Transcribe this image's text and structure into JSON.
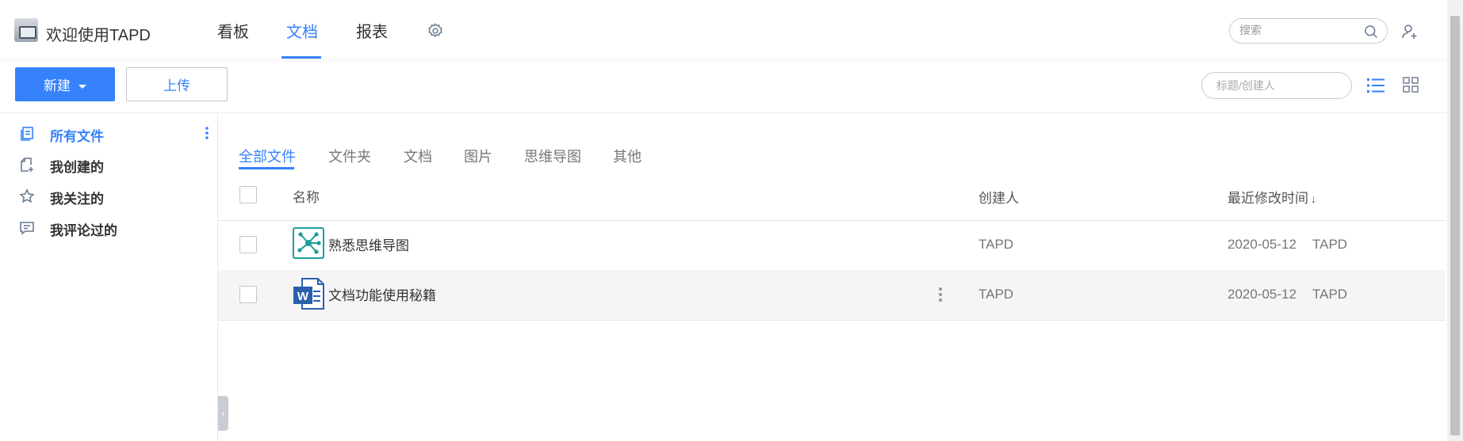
{
  "header": {
    "app_title": "欢迎使用TAPD",
    "nav_tabs": [
      {
        "label": "看板"
      },
      {
        "label": "文档"
      },
      {
        "label": "报表"
      }
    ],
    "active_tab": "文档",
    "search_placeholder": "搜索"
  },
  "toolbar": {
    "new_label": "新建",
    "upload_label": "上传",
    "filter_placeholder": "标题/创建人"
  },
  "sidebar": {
    "items": [
      {
        "label": "所有文件",
        "icon": "files-icon"
      },
      {
        "label": "我创建的",
        "icon": "created-icon"
      },
      {
        "label": "我关注的",
        "icon": "star-icon"
      },
      {
        "label": "我评论过的",
        "icon": "comment-icon"
      }
    ],
    "active_item": "所有文件"
  },
  "content": {
    "tabs": [
      {
        "label": "全部文件"
      },
      {
        "label": "文件夹"
      },
      {
        "label": "文档"
      },
      {
        "label": "图片"
      },
      {
        "label": "思维导图"
      },
      {
        "label": "其他"
      }
    ],
    "active_tab": "全部文件",
    "columns": {
      "name": "名称",
      "creator": "创建人",
      "modified": "最近修改时间"
    },
    "rows": [
      {
        "name": "熟悉思维导图",
        "type": "mindmap-icon",
        "creator": "TAPD",
        "modified_date": "2020-05-12",
        "modified_by": "TAPD"
      },
      {
        "name": "文档功能使用秘籍",
        "type": "word-doc-icon",
        "creator": "TAPD",
        "modified_date": "2020-05-12",
        "modified_by": "TAPD"
      }
    ]
  },
  "colors": {
    "accent": "#3582fb",
    "mindmap_icon": "#1f9e9a",
    "doc_icon": "#2b5fad"
  }
}
